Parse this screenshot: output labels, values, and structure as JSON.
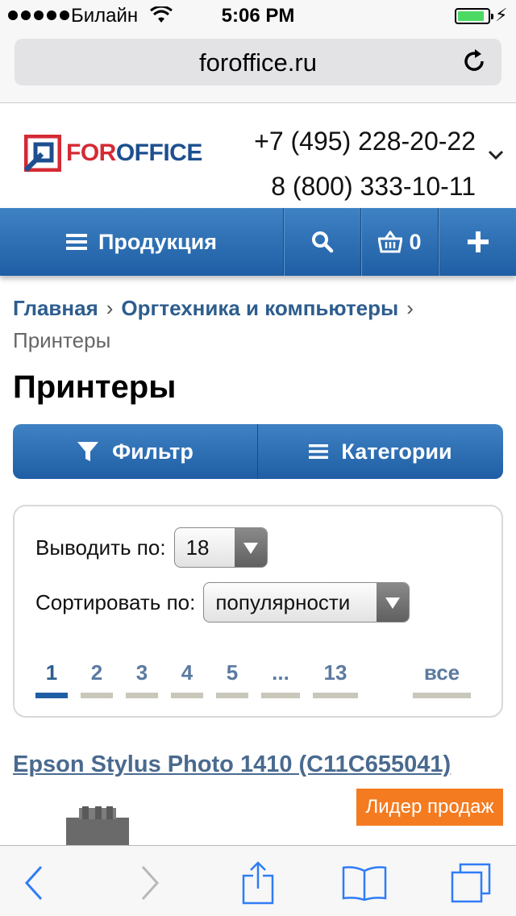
{
  "status_bar": {
    "carrier": "Билайн",
    "time": "5:06 PM",
    "signal_icon": "signal-dots-icon",
    "wifi_icon": "wifi-icon",
    "battery_icon": "battery-icon",
    "charging_icon": "charging-icon"
  },
  "browser": {
    "url": "foroffice.ru",
    "reload_icon": "reload-icon"
  },
  "header": {
    "logo_text_red": "FOR",
    "logo_text_blue": "OFFICE",
    "phone_1": "+7 (495) 228-20-22",
    "phone_2": "8 (800) 333-10-11"
  },
  "nav": {
    "products_label": "Продукция",
    "cart_count": "0",
    "icons": [
      "menu-icon",
      "search-icon",
      "basket-icon",
      "plus-icon"
    ]
  },
  "breadcrumb": {
    "items": [
      "Главная",
      "Оргтехника и компьютеры"
    ],
    "current": "Принтеры"
  },
  "page_title": "Принтеры",
  "toolbar": {
    "filter_label": "Фильтр",
    "categories_label": "Категории"
  },
  "listing": {
    "per_page_label": "Выводить по:",
    "per_page_value": "18",
    "sort_label": "Сортировать по:",
    "sort_value": "популярности",
    "pages": [
      "1",
      "2",
      "3",
      "4",
      "5",
      "...",
      "13",
      "все"
    ],
    "active_page": "1"
  },
  "product": {
    "title": "Epson Stylus Photo 1410 (C11C655041)",
    "badge": "Лидер продаж"
  },
  "colors": {
    "nav_blue": "#1f5ea4",
    "link_blue": "#2d5d8e",
    "logo_red": "#d42a34",
    "badge_orange": "#f47b20",
    "ios_blue": "#2f7cf6"
  }
}
